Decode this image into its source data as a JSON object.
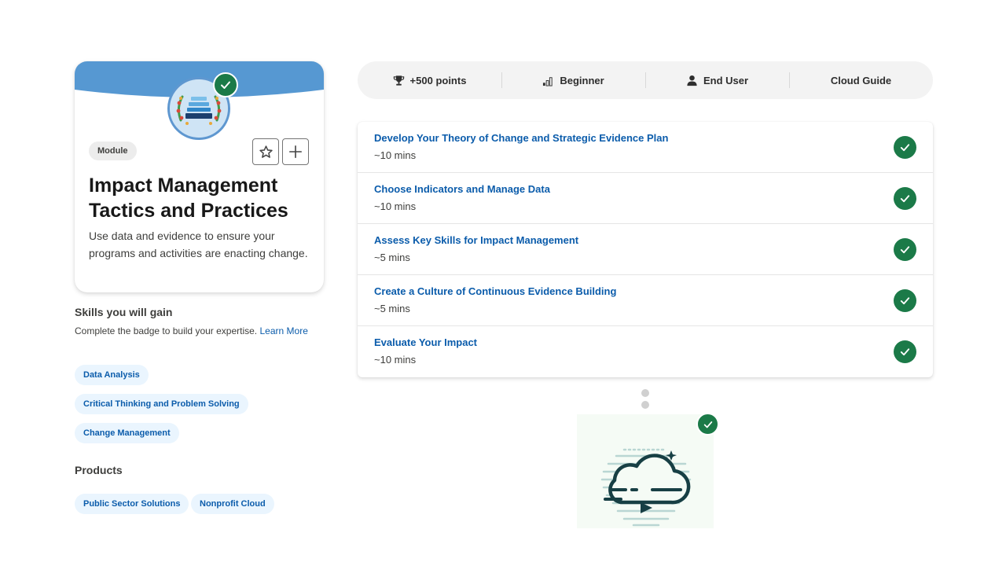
{
  "badge": {
    "type_label": "Module",
    "title": "Impact Management Tactics and Practices",
    "description": "Use data and evidence to ensure your programs and activities are enacting change.",
    "banner_color": "#5698d2",
    "completed": true,
    "favorite_icon": "star-icon",
    "add_icon": "plus-icon"
  },
  "skills": {
    "heading": "Skills you will gain",
    "text": "Complete the badge to build your expertise.",
    "link_label": "Learn More",
    "tags": [
      "Data Analysis",
      "Critical Thinking and Problem Solving",
      "Change Management"
    ]
  },
  "products": {
    "heading": "Products",
    "tags": [
      "Public Sector Solutions",
      "Nonprofit Cloud"
    ]
  },
  "stats": [
    {
      "icon": "trophy-icon",
      "label": "+500 points"
    },
    {
      "icon": "signal-bars-icon",
      "label": "Beginner"
    },
    {
      "icon": "user-icon",
      "label": "End User"
    },
    {
      "icon": "",
      "label": "Cloud Guide"
    }
  ],
  "units": [
    {
      "title": "Develop Your Theory of Change and Strategic Evidence Plan",
      "time": "~10 mins",
      "completed": true
    },
    {
      "title": "Choose Indicators and Manage Data",
      "time": "~10 mins",
      "completed": true
    },
    {
      "title": "Assess Key Skills for Impact Management",
      "time": "~5 mins",
      "completed": true
    },
    {
      "title": "Create a Culture of Continuous Evidence Building",
      "time": "~5 mins",
      "completed": true
    },
    {
      "title": "Evaluate Your Impact",
      "time": "~10 mins",
      "completed": true
    }
  ],
  "final_step": {
    "icon": "cloud-video-icon",
    "completed": true
  },
  "colors": {
    "link": "#0b5cab",
    "success": "#1b7a48",
    "tag_bg": "#eaf5fe"
  }
}
